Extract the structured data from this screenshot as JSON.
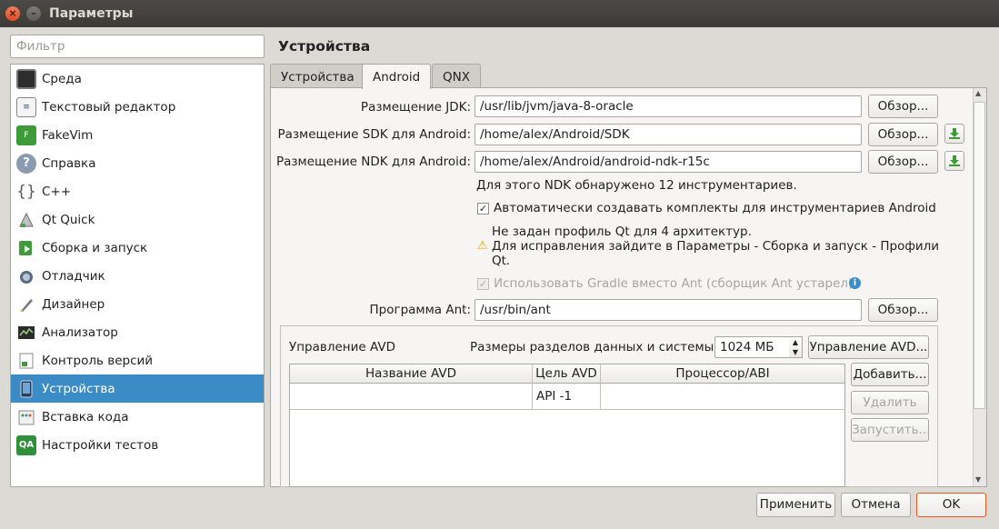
{
  "window": {
    "title": "Параметры",
    "close_glyph": "×",
    "min_glyph": "–"
  },
  "filter": {
    "placeholder": "Фильтр"
  },
  "categories": [
    {
      "label": "Среда",
      "icon": "monitor-icon"
    },
    {
      "label": "Текстовый редактор",
      "icon": "text-editor-icon"
    },
    {
      "label": "FakeVim",
      "icon": "fakevim-icon"
    },
    {
      "label": "Справка",
      "icon": "help-icon"
    },
    {
      "label": "C++",
      "icon": "braces-icon"
    },
    {
      "label": "Qt Quick",
      "icon": "qt-quick-icon"
    },
    {
      "label": "Сборка и запуск",
      "icon": "build-run-icon"
    },
    {
      "label": "Отладчик",
      "icon": "debugger-icon"
    },
    {
      "label": "Дизайнер",
      "icon": "designer-icon"
    },
    {
      "label": "Анализатор",
      "icon": "analyzer-icon"
    },
    {
      "label": "Контроль версий",
      "icon": "version-control-icon"
    },
    {
      "label": "Устройства",
      "icon": "device-icon",
      "selected": true
    },
    {
      "label": "Вставка кода",
      "icon": "code-paste-icon"
    },
    {
      "label": "Настройки тестов",
      "icon": "qa-icon",
      "glyph": "QA"
    }
  ],
  "page": {
    "title": "Устройства",
    "tabs": [
      {
        "label": "Устройства"
      },
      {
        "label": "Android",
        "active": true
      },
      {
        "label": "QNX"
      }
    ]
  },
  "android": {
    "jdk_label": "Размещение JDK:",
    "jdk_value": "/usr/lib/jvm/java-8-oracle",
    "sdk_label": "Размещение SDK для Android:",
    "sdk_value": "/home/alex/Android/SDK",
    "ndk_label": "Размещение NDK для Android:",
    "ndk_value": "/home/alex/Android/android-ndk-r15c",
    "browse_label": "Обзор...",
    "ndk_info": "Для этого NDK обнаружено 12 инструментариев.",
    "auto_kits_label": "Автоматически создавать комплекты для инструментариев Android",
    "warning_line1": "Не задан профиль Qt для 4 архитектур.",
    "warning_line2": "Для исправления зайдите в Параметры - Сборка и запуск - Профили",
    "warning_line3": "Qt.",
    "gradle_label": "Использовать Gradle вместо Ant (сборщик Ant устарел)",
    "ant_label": "Программа Ant:",
    "ant_value": "/usr/bin/ant",
    "check_glyph": "✓",
    "warning_glyph": "⚠",
    "info_glyph": "i"
  },
  "avd": {
    "group_label": "Управление AVD",
    "partition_label": "Размеры разделов данных и системы:",
    "partition_value": "1024 МБ",
    "manage_button": "Управление AVD...",
    "columns": [
      "Название AVD",
      "Цель AVD",
      "Процессор/ABI"
    ],
    "rows": [
      [
        "",
        "API -1",
        ""
      ]
    ],
    "add_button": "Добавить...",
    "delete_button": "Удалить",
    "start_button": "Запустить..."
  },
  "footer": {
    "apply": "Применить",
    "cancel": "Отмена",
    "ok": "OK"
  },
  "colors": {
    "selection": "#3b8cc6",
    "titlebar": "#3c3b37",
    "close": "#e95420",
    "download": "#3d9b35",
    "warning": "#f0b400",
    "info": "#3b8cc6"
  }
}
